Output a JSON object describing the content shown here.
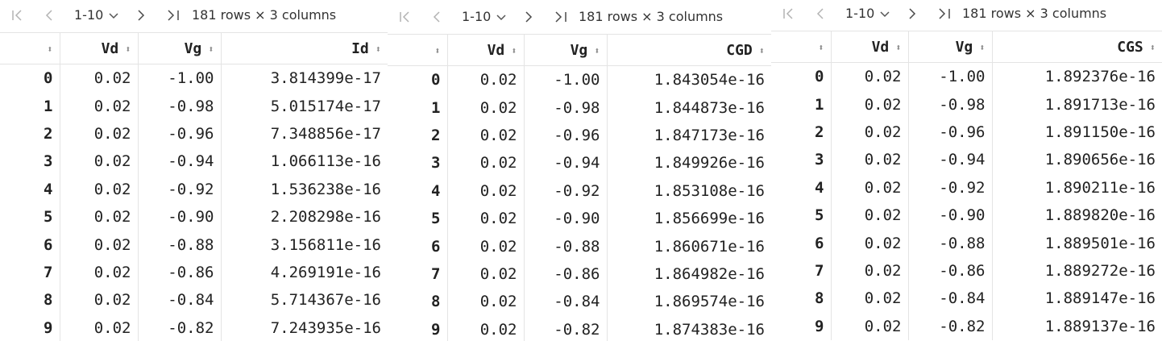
{
  "panels": [
    {
      "range_label": "1-10",
      "row_count": "181 rows × 3 columns",
      "columns": [
        "Vd",
        "Vg",
        "Id"
      ],
      "rows": [
        [
          "0",
          "0.02",
          "-1.00",
          "3.814399e-17"
        ],
        [
          "1",
          "0.02",
          "-0.98",
          "5.015174e-17"
        ],
        [
          "2",
          "0.02",
          "-0.96",
          "7.348856e-17"
        ],
        [
          "3",
          "0.02",
          "-0.94",
          "1.066113e-16"
        ],
        [
          "4",
          "0.02",
          "-0.92",
          "1.536238e-16"
        ],
        [
          "5",
          "0.02",
          "-0.90",
          "2.208298e-16"
        ],
        [
          "6",
          "0.02",
          "-0.88",
          "3.156811e-16"
        ],
        [
          "7",
          "0.02",
          "-0.86",
          "4.269191e-16"
        ],
        [
          "8",
          "0.02",
          "-0.84",
          "5.714367e-16"
        ],
        [
          "9",
          "0.02",
          "-0.82",
          "7.243935e-16"
        ]
      ]
    },
    {
      "range_label": "1-10",
      "row_count": "181 rows × 3 columns",
      "columns": [
        "Vd",
        "Vg",
        "CGD"
      ],
      "rows": [
        [
          "0",
          "0.02",
          "-1.00",
          "1.843054e-16"
        ],
        [
          "1",
          "0.02",
          "-0.98",
          "1.844873e-16"
        ],
        [
          "2",
          "0.02",
          "-0.96",
          "1.847173e-16"
        ],
        [
          "3",
          "0.02",
          "-0.94",
          "1.849926e-16"
        ],
        [
          "4",
          "0.02",
          "-0.92",
          "1.853108e-16"
        ],
        [
          "5",
          "0.02",
          "-0.90",
          "1.856699e-16"
        ],
        [
          "6",
          "0.02",
          "-0.88",
          "1.860671e-16"
        ],
        [
          "7",
          "0.02",
          "-0.86",
          "1.864982e-16"
        ],
        [
          "8",
          "0.02",
          "-0.84",
          "1.869574e-16"
        ],
        [
          "9",
          "0.02",
          "-0.82",
          "1.874383e-16"
        ]
      ]
    },
    {
      "range_label": "1-10",
      "row_count": "181 rows × 3 columns",
      "columns": [
        "Vd",
        "Vg",
        "CGS"
      ],
      "rows": [
        [
          "0",
          "0.02",
          "-1.00",
          "1.892376e-16"
        ],
        [
          "1",
          "0.02",
          "-0.98",
          "1.891713e-16"
        ],
        [
          "2",
          "0.02",
          "-0.96",
          "1.891150e-16"
        ],
        [
          "3",
          "0.02",
          "-0.94",
          "1.890656e-16"
        ],
        [
          "4",
          "0.02",
          "-0.92",
          "1.890211e-16"
        ],
        [
          "5",
          "0.02",
          "-0.90",
          "1.889820e-16"
        ],
        [
          "6",
          "0.02",
          "-0.88",
          "1.889501e-16"
        ],
        [
          "7",
          "0.02",
          "-0.86",
          "1.889272e-16"
        ],
        [
          "8",
          "0.02",
          "-0.84",
          "1.889147e-16"
        ],
        [
          "9",
          "0.02",
          "-0.82",
          "1.889137e-16"
        ]
      ]
    }
  ],
  "icons": {
    "first": "first-page-icon",
    "prev": "previous-page-icon",
    "dropdown": "chevron-down-icon",
    "next": "next-page-icon",
    "last": "last-page-icon",
    "sort": "sort-icon"
  },
  "colors": {
    "border": "#e4e4e4",
    "disabled_icon": "#b3b3b3",
    "text": "#222222"
  }
}
